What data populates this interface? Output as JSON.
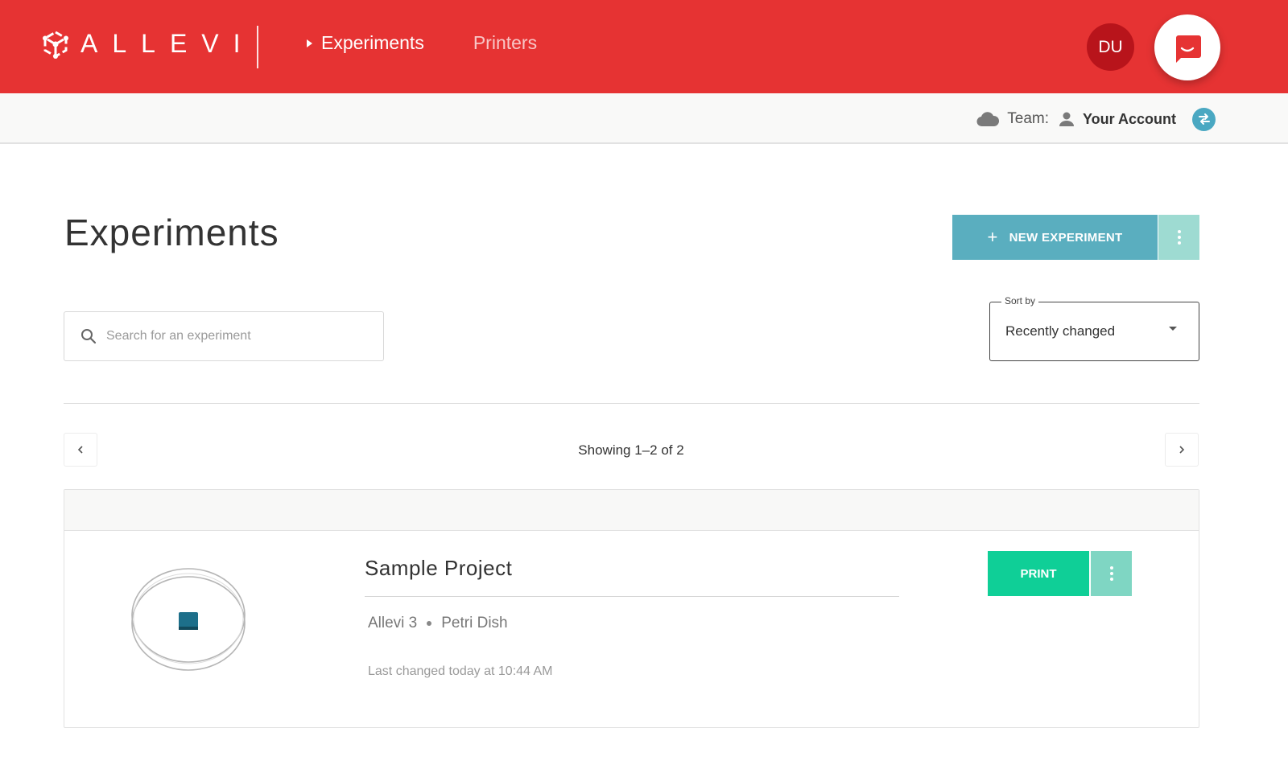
{
  "header": {
    "brand": "ALLEVI",
    "nav": [
      {
        "label": "Experiments",
        "active": true
      },
      {
        "label": "Printers",
        "active": false
      }
    ],
    "avatar_initials": "DU",
    "brand_color": "#e63333"
  },
  "teambar": {
    "team_label": "Team:",
    "account_name": "Your Account"
  },
  "main": {
    "title": "Experiments",
    "new_experiment_label": "NEW EXPERIMENT",
    "search_placeholder": "Search for an experiment",
    "sort": {
      "label": "Sort by",
      "value": "Recently changed"
    },
    "pagination": {
      "showing": "Showing 1–2 of 2"
    },
    "experiments": [
      {
        "title": "Sample Project",
        "printer": "Allevi 3",
        "container": "Petri Dish",
        "last_changed": "Last changed today at 10:44 AM",
        "print_label": "PRINT"
      }
    ]
  }
}
